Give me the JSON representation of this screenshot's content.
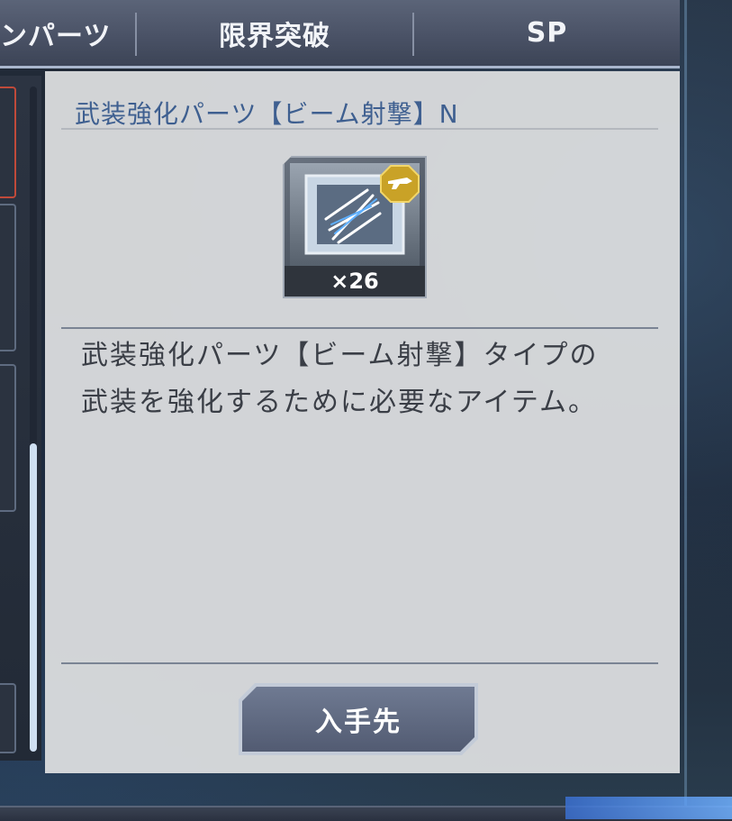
{
  "tabs": [
    {
      "label": "ンパーツ"
    },
    {
      "label": "限界突破"
    },
    {
      "label": "SP"
    }
  ],
  "item": {
    "title": "武装強化パーツ【ビーム射撃】N",
    "count": "×26",
    "icon_name": "beam-shot-parts-icon",
    "type_badge": "beam-rifle-badge-icon",
    "badge_color": "#c9a227"
  },
  "description": {
    "line1": "武装強化パーツ【ビーム射撃】タイプの",
    "line2": "武装を強化するために必要なアイテム。"
  },
  "acquire_button": {
    "label": "入手先"
  }
}
